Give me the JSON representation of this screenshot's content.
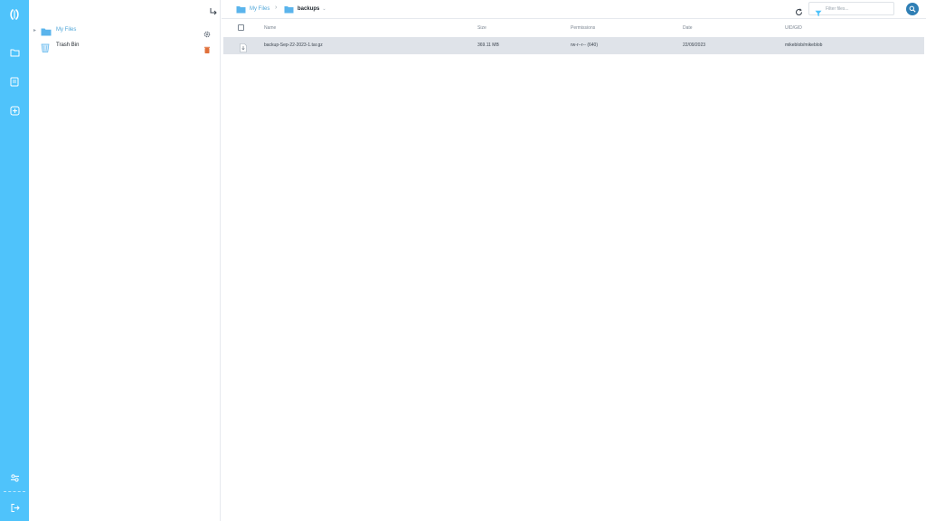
{
  "colors": {
    "accent": "#4fc3fb",
    "folder": "#5ab4ec",
    "link": "#4fa6d8",
    "search": "#2f7fb5",
    "trash": "#e0703a",
    "row_selected": "#dfe3e9"
  },
  "rail": {
    "icons": [
      "app-logo-icon",
      "folder-icon",
      "document-icon",
      "add-icon",
      "settings-sliders-icon",
      "logout-icon"
    ]
  },
  "tree": {
    "items": [
      {
        "label": "My Files",
        "icon": "folder-icon",
        "tail_icon": "gear-icon"
      },
      {
        "label": "Trash Bin",
        "icon": "trash-bin-icon",
        "tail_icon": "trash-icon"
      }
    ]
  },
  "breadcrumb": {
    "items": [
      {
        "label": "My Files"
      },
      {
        "label": "backups"
      }
    ],
    "dropdown_indicator": "⌄"
  },
  "filter": {
    "placeholder": "Filter files..."
  },
  "table": {
    "columns": [
      "Name",
      "Size",
      "Permissions",
      "Date",
      "UID/GID"
    ],
    "rows": [
      {
        "name": "backup-Sep-22-2023-1.tar.gz",
        "size": "369.11 MB",
        "permissions": "rw-r--r-- (640)",
        "date": "22/09/2023",
        "uid_gid": "mikeblob/mikeblob"
      }
    ]
  }
}
